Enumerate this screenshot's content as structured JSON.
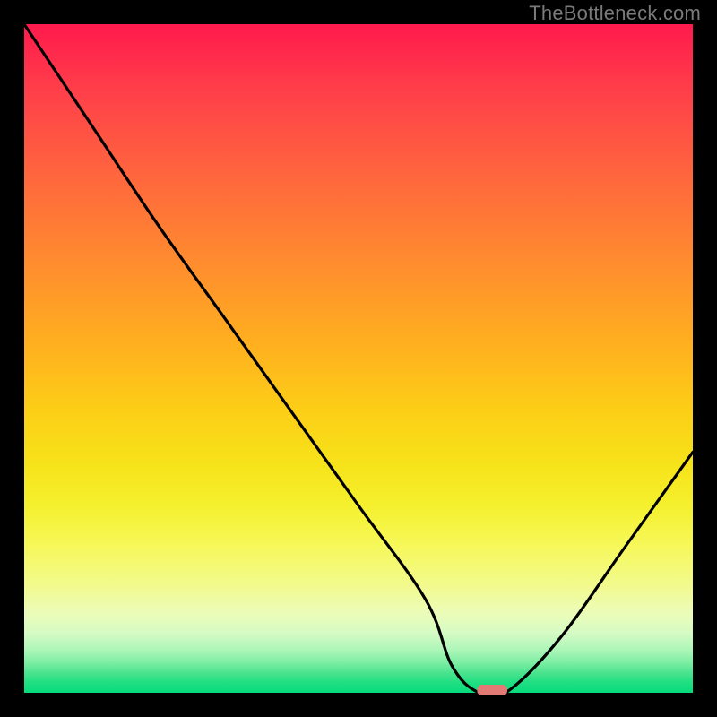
{
  "watermark": "TheBottleneck.com",
  "chart_data": {
    "type": "line",
    "title": "",
    "xlabel": "",
    "ylabel": "",
    "xlim": [
      0,
      100
    ],
    "ylim": [
      0,
      100
    ],
    "grid": false,
    "legend": false,
    "series": [
      {
        "name": "bottleneck-curve",
        "x": [
          0,
          10,
          20,
          30,
          40,
          50,
          60,
          64,
          68,
          72,
          80,
          90,
          100
        ],
        "values": [
          100,
          85,
          70,
          56,
          42,
          28,
          14,
          4,
          0,
          0,
          8,
          22,
          36
        ]
      }
    ],
    "marker": {
      "x": 70,
      "y": 0,
      "width": 4.5,
      "height": 1.6,
      "color": "#e17a74"
    },
    "background_gradient": {
      "type": "vertical",
      "stops": [
        {
          "pos": 0.0,
          "color": "#ff1a4d"
        },
        {
          "pos": 0.5,
          "color": "#ffb01f"
        },
        {
          "pos": 0.78,
          "color": "#f6f85a"
        },
        {
          "pos": 1.0,
          "color": "#06db7c"
        }
      ]
    }
  }
}
